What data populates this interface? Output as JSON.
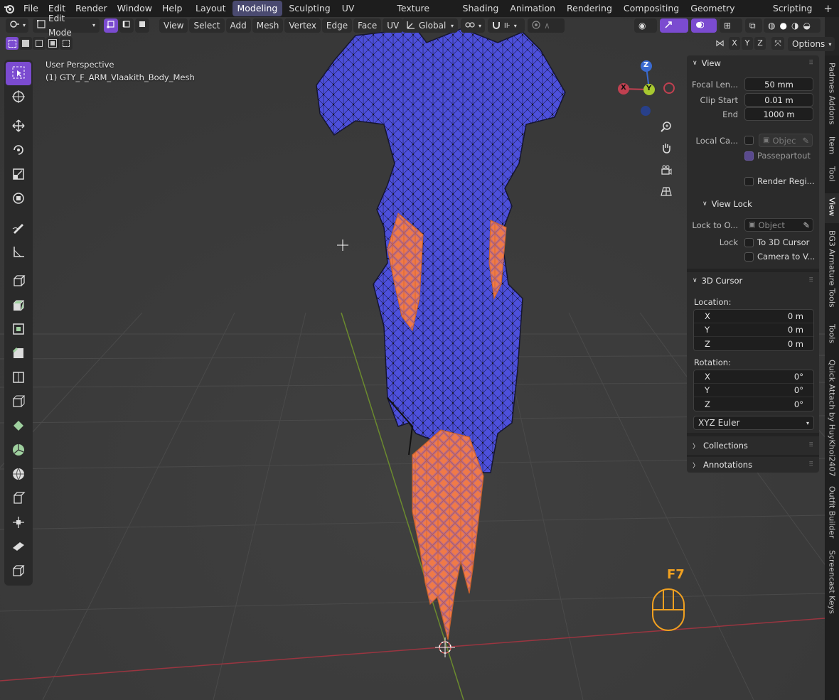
{
  "menu": {
    "items": [
      "File",
      "Edit",
      "Render",
      "Window",
      "Help"
    ]
  },
  "workspaces": {
    "tabs": [
      "Layout",
      "Modeling",
      "Sculpting",
      "UV Editing",
      "Texture Paint",
      "Shading",
      "Animation",
      "Rendering",
      "Compositing",
      "Geometry Nodes",
      "Scripting"
    ],
    "active": "Modeling",
    "add_symbol": "+"
  },
  "header": {
    "mode": "Edit Mode",
    "menus": [
      "View",
      "Select",
      "Add",
      "Mesh",
      "Vertex",
      "Edge",
      "Face",
      "UV"
    ],
    "orientation": "Global",
    "axis_x": "X",
    "axis_y": "Y",
    "axis_z": "Z",
    "options": "Options"
  },
  "viewport": {
    "perspective": "User Perspective",
    "object": "(1) GTY_F_ARM_Vlaakith_Body_Mesh",
    "key_overlay": "F7",
    "colors": {
      "mesh": "#4b4de0",
      "selected": "#f07a4a",
      "grid": "#474747",
      "x_axis": "#a13a45",
      "y_axis": "#6a8a2a"
    }
  },
  "gizmo": {
    "x": "X",
    "y": "Y",
    "z": "Z"
  },
  "npanel": {
    "view": {
      "title": "View",
      "focal_label": "Focal Len...",
      "focal_value": "50 mm",
      "clip_start_label": "Clip Start",
      "clip_start_value": "0.01 m",
      "end_label": "End",
      "end_value": "1000 m",
      "local_camera_label": "Local Ca...",
      "local_camera_placeholder": "Objec",
      "passepartout": "Passepartout",
      "render_region": "Render Regi..."
    },
    "view_lock": {
      "title": "View Lock",
      "lock_to_label": "Lock to O...",
      "lock_to_placeholder": "Object",
      "lock_label": "Lock",
      "to_3d_cursor": "To 3D Cursor",
      "camera_to_view": "Camera to V..."
    },
    "cursor": {
      "title": "3D Cursor",
      "location_label": "Location:",
      "location": [
        {
          "axis": "X",
          "value": "0 m"
        },
        {
          "axis": "Y",
          "value": "0 m"
        },
        {
          "axis": "Z",
          "value": "0 m"
        }
      ],
      "rotation_label": "Rotation:",
      "rotation": [
        {
          "axis": "X",
          "value": "0°"
        },
        {
          "axis": "Y",
          "value": "0°"
        },
        {
          "axis": "Z",
          "value": "0°"
        }
      ],
      "rotation_mode": "XYZ Euler"
    },
    "collections": "Collections",
    "annotations": "Annotations"
  },
  "sidebar_tabs": [
    "Padmes Addons",
    "Item",
    "Tool",
    "View",
    "BG3 Armature Tools",
    "Tools",
    "Quick Attach by HuyKhoi2407",
    "Outfit Builder",
    "Screencast Keys"
  ],
  "sidebar_active": "View"
}
